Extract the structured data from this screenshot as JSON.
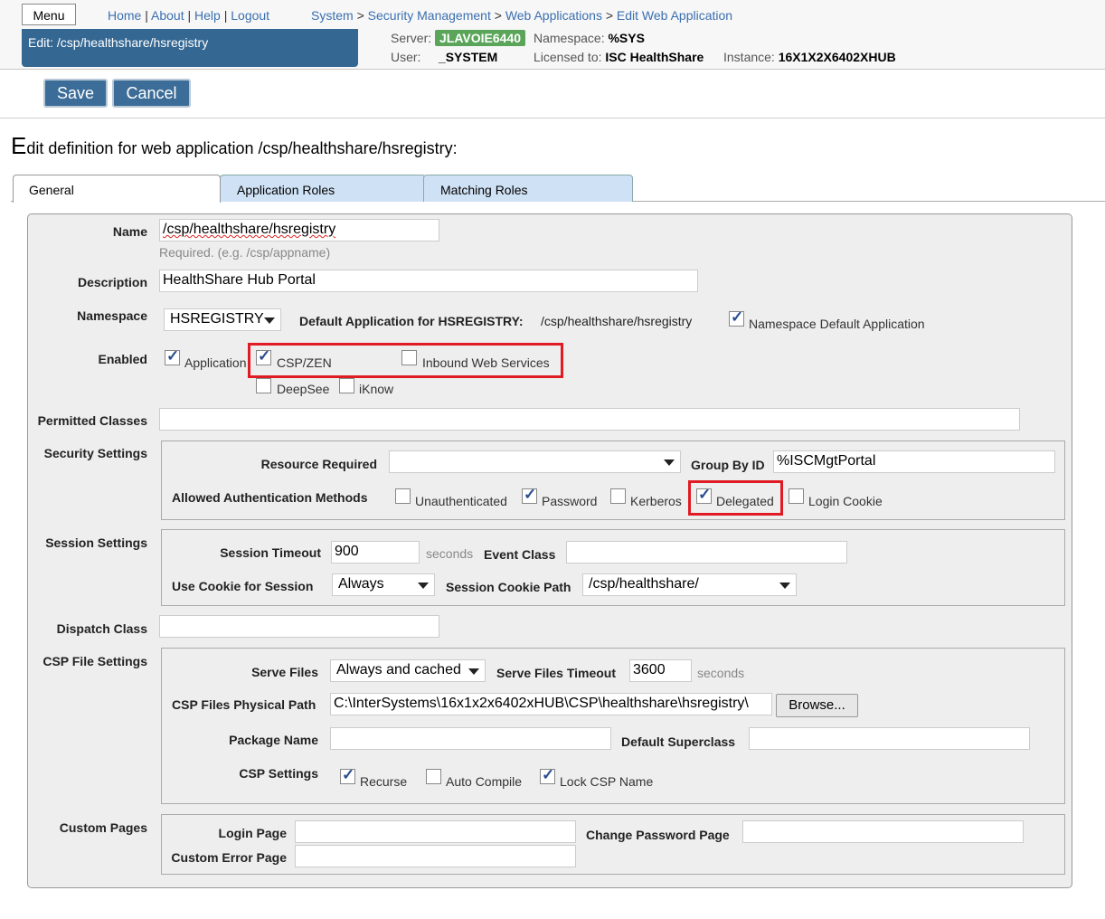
{
  "header": {
    "menu_label": "Menu",
    "links": [
      "Home",
      "About",
      "Help",
      "Logout"
    ],
    "breadcrumbs": [
      "System",
      "Security Management",
      "Web Applications",
      "Edit Web Application"
    ],
    "edit_banner": "Edit: /csp/healthshare/hsregistry",
    "server_label": "Server:",
    "server_value": "JLAVOIE6440",
    "namespace_label": "Namespace:",
    "namespace_value": "%SYS",
    "user_label": "User:",
    "user_value": "_SYSTEM",
    "licensed_label": "Licensed to:",
    "licensed_value": "ISC HealthShare",
    "instance_label": "Instance:",
    "instance_value": "16X1X2X6402XHUB"
  },
  "actions": {
    "save": "Save",
    "cancel": "Cancel"
  },
  "page_title_first": "E",
  "page_title_rest": "dit definition for web application /csp/healthshare/hsregistry:",
  "tabs": [
    "General",
    "Application Roles",
    "Matching Roles"
  ],
  "form": {
    "name_label": "Name",
    "name_value": "/csp/healthshare/hsregistry",
    "name_hint": "Required. (e.g. /csp/appname)",
    "description_label": "Description",
    "description_value": "HealthShare Hub Portal",
    "namespace_label": "Namespace",
    "namespace_value": "HSREGISTRY",
    "default_app_label": "Default Application for HSREGISTRY:",
    "default_app_value": "/csp/healthshare/hsregistry",
    "ns_default_app_label": "Namespace Default Application",
    "ns_default_app_checked": true,
    "enabled_label": "Enabled",
    "enabled": [
      {
        "label": "Application",
        "checked": true
      },
      {
        "label": "CSP/ZEN",
        "checked": true
      },
      {
        "label": "Inbound Web Services",
        "checked": false
      },
      {
        "label": "DeepSee",
        "checked": false
      },
      {
        "label": "iKnow",
        "checked": false
      }
    ],
    "permitted_classes_label": "Permitted Classes",
    "permitted_classes_value": "",
    "security_label": "Security Settings",
    "resource_required_label": "Resource Required",
    "resource_required_value": "",
    "group_by_id_label": "Group By ID",
    "group_by_id_value": "%ISCMgtPortal",
    "auth_methods_label": "Allowed Authentication Methods",
    "auth_methods": [
      {
        "label": "Unauthenticated",
        "checked": false
      },
      {
        "label": "Password",
        "checked": true
      },
      {
        "label": "Kerberos",
        "checked": false
      },
      {
        "label": "Delegated",
        "checked": true
      },
      {
        "label": "Login Cookie",
        "checked": false
      }
    ],
    "session_label": "Session Settings",
    "session_timeout_label": "Session Timeout",
    "session_timeout_value": "900",
    "seconds": "seconds",
    "event_class_label": "Event Class",
    "event_class_value": "",
    "use_cookie_label": "Use Cookie for Session",
    "use_cookie_value": "Always",
    "cookie_path_label": "Session Cookie Path",
    "cookie_path_value": "/csp/healthshare/",
    "dispatch_label": "Dispatch Class",
    "dispatch_value": "",
    "csp_file_label": "CSP File Settings",
    "serve_files_label": "Serve Files",
    "serve_files_value": "Always and cached",
    "serve_files_timeout_label": "Serve Files Timeout",
    "serve_files_timeout_value": "3600",
    "physical_path_label": "CSP Files Physical Path",
    "physical_path_value": "C:\\InterSystems\\16x1x2x6402xHUB\\CSP\\healthshare\\hsregistry\\",
    "browse_label": "Browse...",
    "package_name_label": "Package Name",
    "package_name_value": "",
    "default_superclass_label": "Default Superclass",
    "default_superclass_value": "",
    "csp_settings_label": "CSP Settings",
    "csp_settings": [
      {
        "label": "Recurse",
        "checked": true
      },
      {
        "label": "Auto Compile",
        "checked": false
      },
      {
        "label": "Lock CSP Name",
        "checked": true
      }
    ],
    "custom_pages_label": "Custom Pages",
    "login_page_label": "Login Page",
    "login_page_value": "",
    "change_pw_label": "Change Password Page",
    "change_pw_value": "",
    "custom_error_label": "Custom Error Page",
    "custom_error_value": ""
  },
  "colors": {
    "header_blue": "#346792",
    "button_blue": "#3c6d98",
    "tab_blue": "#cfe1f4",
    "highlight_red": "#e01b24",
    "server_green": "#5aa55a"
  }
}
